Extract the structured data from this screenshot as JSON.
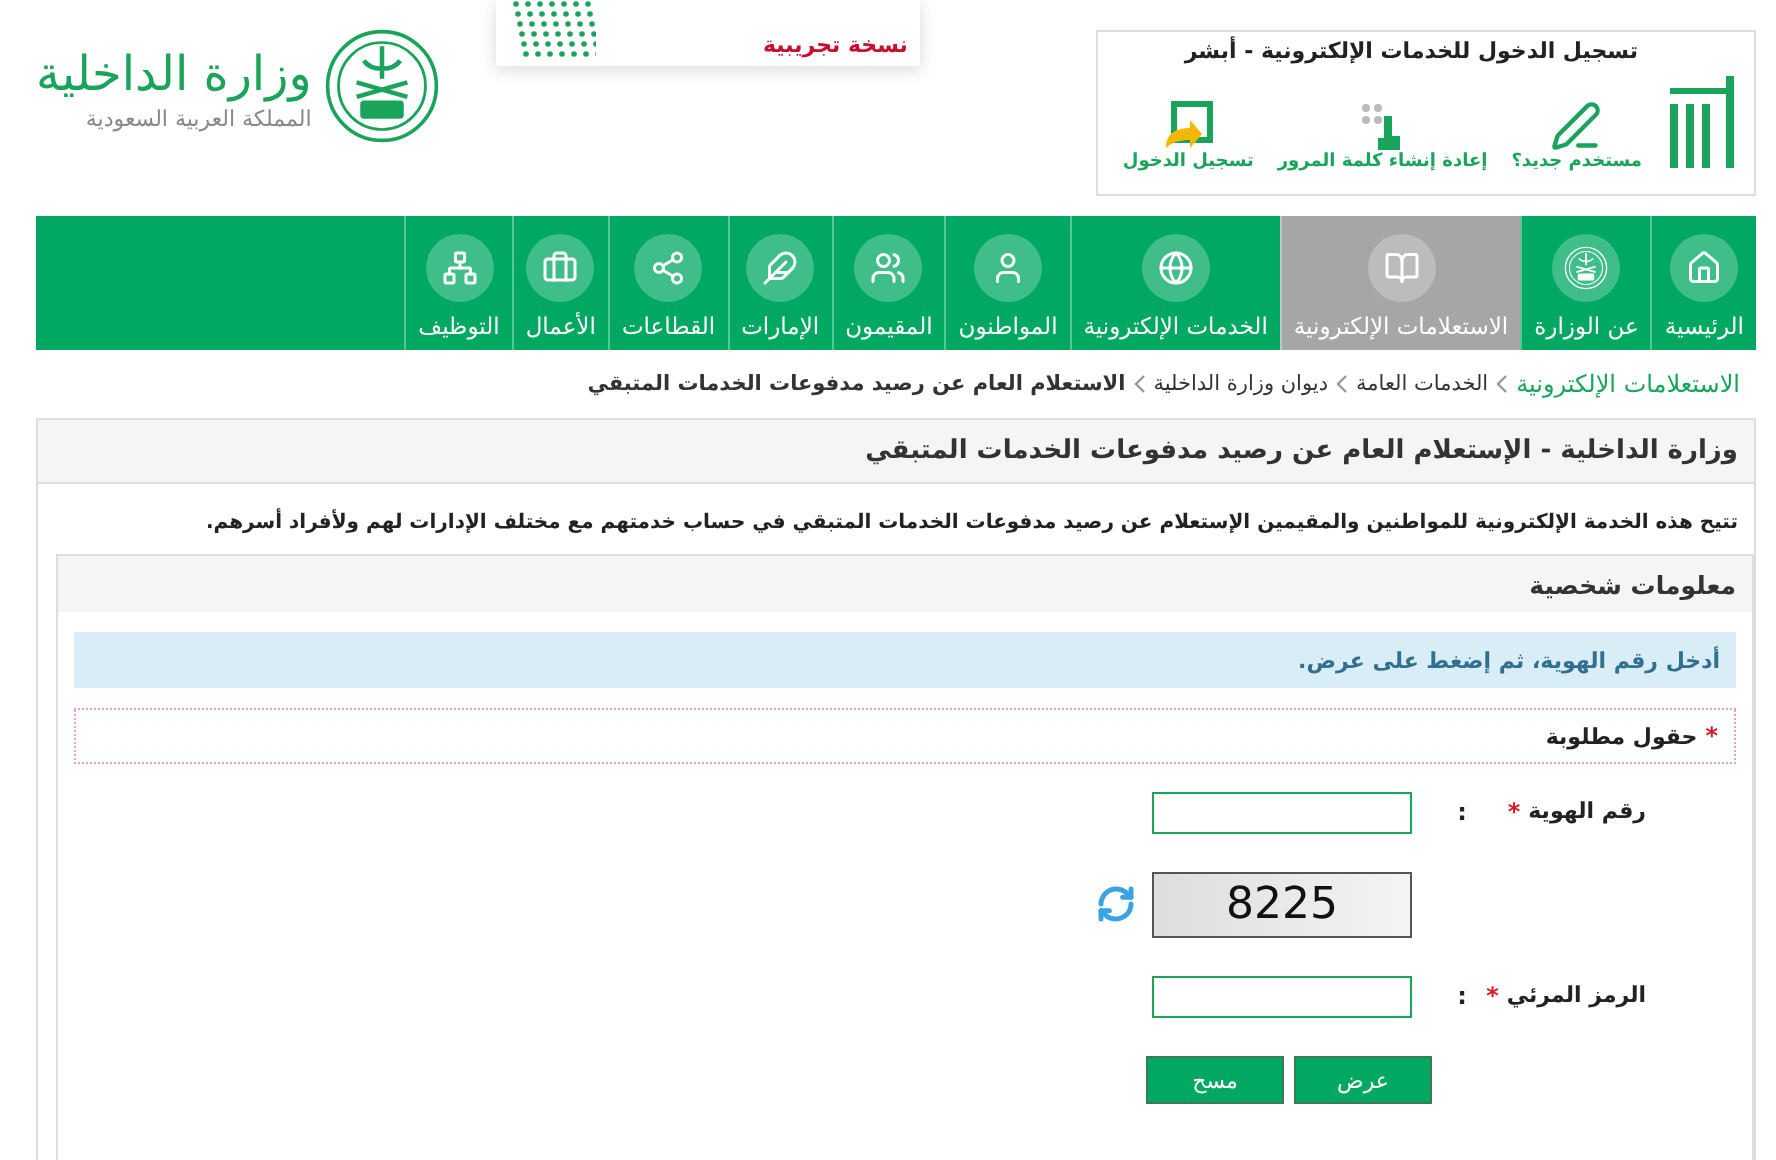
{
  "header": {
    "logo": {
      "title": "وزارة الداخلية",
      "subtitle": "المملكة العربية السعودية"
    },
    "banner": {
      "subtitle": "نسخة تجريبية"
    },
    "abshir_box": {
      "title": "تسجيل الدخول للخدمات الإلكترونية - أبشر",
      "links": [
        {
          "label": "مستخدم جديد؟"
        },
        {
          "label": "إعادة إنشاء كلمة المرور"
        },
        {
          "label": "تسجيل الدخول"
        }
      ]
    }
  },
  "nav": {
    "items": [
      {
        "label": "الرئيسية",
        "selected": false
      },
      {
        "label": "عن الوزارة",
        "selected": false
      },
      {
        "label": "الاستعلامات الإلكترونية",
        "selected": true
      },
      {
        "label": "الخدمات الإلكترونية",
        "selected": false
      },
      {
        "label": "المواطنون",
        "selected": false
      },
      {
        "label": "المقيمون",
        "selected": false
      },
      {
        "label": "الإمارات",
        "selected": false
      },
      {
        "label": "القطاعات",
        "selected": false
      },
      {
        "label": "الأعمال",
        "selected": false
      },
      {
        "label": "التوظيف",
        "selected": false
      }
    ]
  },
  "breadcrumb": [
    {
      "label": "الاستعلامات الإلكترونية",
      "kind": "link"
    },
    {
      "label": "الخدمات العامة",
      "kind": "item"
    },
    {
      "label": "ديوان وزارة الداخلية",
      "kind": "item"
    },
    {
      "label": "الاستعلام العام عن رصيد مدفوعات الخدمات المتبقي",
      "kind": "current"
    }
  ],
  "page": {
    "title": "وزارة الداخلية - الإستعلام العام عن رصيد مدفوعات الخدمات المتبقي",
    "description": "تتيح هذه الخدمة الإلكترونية للمواطنين والمقيمين الإستعلام عن رصيد مدفوعات الخدمات المتبقي في حساب خدمتهم مع مختلف الإدارات لهم ولأفراد أسرهم."
  },
  "section": {
    "title": "معلومات شخصية",
    "alert": "أدخل رقم الهوية، ثم إضغط على عرض.",
    "required_note": {
      "marker": "*",
      "text": "حقول مطلوبة"
    },
    "fields": [
      {
        "kind": "input",
        "label": "رقم الهوية",
        "marker": "*",
        "separator": ":"
      },
      {
        "kind": "captcha",
        "text": "8225"
      },
      {
        "kind": "input",
        "label": "الرمز المرئي",
        "marker": "*",
        "separator": ":"
      }
    ],
    "buttons": [
      {
        "label": "عرض"
      },
      {
        "label": "مسح"
      }
    ]
  }
}
